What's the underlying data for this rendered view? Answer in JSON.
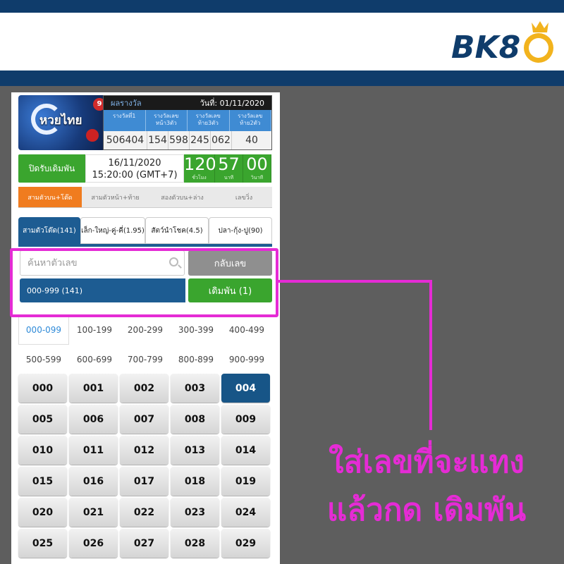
{
  "brand": {
    "logo_text": "BK8"
  },
  "lottery": {
    "thumb_label": "หวยไทย",
    "thumb_ball": "9",
    "results_header_left": "ผลรางวัล",
    "results_date": "วันที่: 01/11/2020",
    "columns": [
      "รางวัลที่1",
      "รางวัลเลข หน้า3ตัว",
      "รางวัลเลข ท้าย3ตัว",
      "รางวัลเลข ท้าย2ตัว"
    ],
    "values": [
      "506404",
      "154",
      "598",
      "245",
      "062",
      "40"
    ]
  },
  "closing": {
    "label": "ปิดรับเดิมพัน",
    "date": "16/11/2020",
    "time": "15:20:00 (GMT+7)",
    "countdown": [
      {
        "num": "120",
        "unit": "ชั่วโมง"
      },
      {
        "num": "57",
        "unit": "นาที"
      },
      {
        "num": "00",
        "unit": "วินาที"
      }
    ]
  },
  "tabs_main": [
    "สามตัวบน+โต๊ด",
    "สามตัวหน้า+ท้าย",
    "สองตัวบน+ล่าง",
    "เลขวิ่ง"
  ],
  "tabs_sub": [
    "สามตัวโต๊ด(141)",
    "เล็ก-ใหญ่-คู่-คี่(1.95)",
    "สัตว์นำโชค(4.5)",
    "ปลา-กุ้ง-ปู(90)"
  ],
  "search": {
    "placeholder": "ค้นหาตัวเลข",
    "reverse_button": "กลับเลข"
  },
  "range_selector": "000-999 (141)",
  "bet_button": "เดิมพัน (1)",
  "ranges": [
    [
      "000-099",
      "100-199",
      "200-299",
      "300-399",
      "400-499"
    ],
    [
      "500-599",
      "600-699",
      "700-799",
      "800-899",
      "900-999"
    ]
  ],
  "numbers": [
    [
      "000",
      "001",
      "002",
      "003",
      "004"
    ],
    [
      "005",
      "006",
      "007",
      "008",
      "009"
    ],
    [
      "010",
      "011",
      "012",
      "013",
      "014"
    ],
    [
      "015",
      "016",
      "017",
      "018",
      "019"
    ],
    [
      "020",
      "021",
      "022",
      "023",
      "024"
    ],
    [
      "025",
      "026",
      "027",
      "028",
      "029"
    ]
  ],
  "selected_number": "004",
  "caption": [
    "ใส่เลขที่จะแทง",
    "แล้วกด เดิมพัน"
  ],
  "colors": {
    "navy": "#0f3c6b",
    "green": "#3aa52e",
    "blue": "#1d5c92",
    "orange": "#f07c1f",
    "magenta": "#e52bd5"
  }
}
